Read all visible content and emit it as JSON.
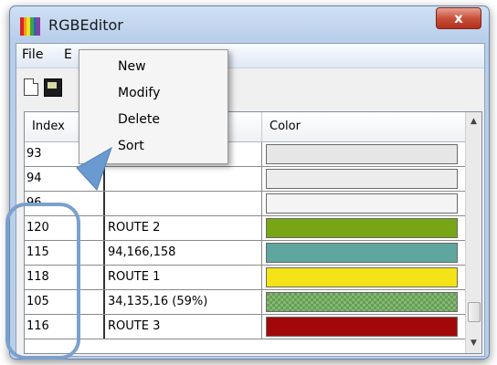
{
  "window": {
    "title": "RGBEditor",
    "close_label": "x",
    "app_icon_colors": [
      "#d9232a",
      "#f29a1b",
      "#efe21e",
      "#3fa24a",
      "#2e63b5",
      "#8b3fa0"
    ]
  },
  "menubar": {
    "file_label": "File",
    "edit_label": "E"
  },
  "toolbar": {
    "new_icon": "new-document-icon",
    "save_icon": "save-disk-icon"
  },
  "grid": {
    "columns": [
      "Index",
      "",
      "Color"
    ],
    "rows": [
      {
        "index": "93",
        "name": "",
        "color": "#e6e6e6",
        "hatched": false
      },
      {
        "index": "94",
        "name": "",
        "color": "#ececec",
        "hatched": false
      },
      {
        "index": "96",
        "name": "",
        "color": "#f4f4f4",
        "hatched": false
      },
      {
        "index": "120",
        "name": "ROUTE 2",
        "color": "#78a516",
        "hatched": false
      },
      {
        "index": "115",
        "name": "94,166,158",
        "color": "#5ea69e",
        "hatched": false
      },
      {
        "index": "118",
        "name": "ROUTE 1",
        "color": "#f4e316",
        "hatched": false
      },
      {
        "index": "105",
        "name": "34,135,16 (59%)",
        "color": "#64a052",
        "hatched": true
      },
      {
        "index": "116",
        "name": "ROUTE 3",
        "color": "#a30808",
        "hatched": false
      }
    ]
  },
  "context_menu": {
    "items": [
      "New",
      "Modify",
      "Delete",
      "Sort"
    ]
  },
  "annotation_colors": {
    "arrow": "#6a9ad0",
    "ring": "#7aa0cf"
  }
}
